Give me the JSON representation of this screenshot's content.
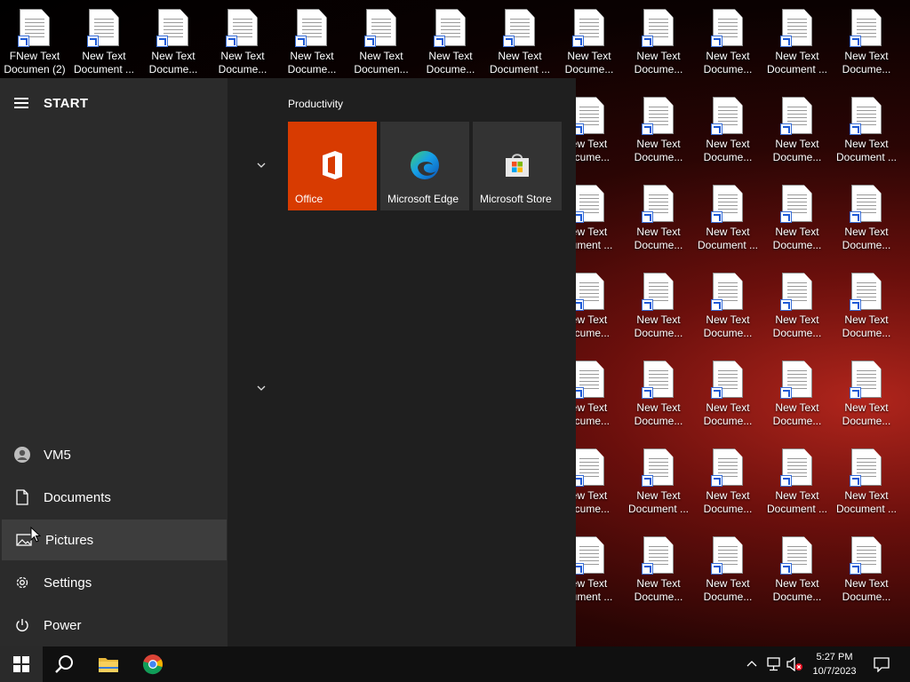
{
  "desktop": {
    "rows": [
      [
        "FNew Text Documen (2)",
        "New Text Document ...",
        "New Text Docume...",
        "New Text Docume...",
        "New Text Docume...",
        "New Text Documen...",
        "New Text Docume...",
        "New Text Document ...",
        "New Text Docume...",
        "New Text Docume...",
        "New Text Docume...",
        "New Text Document ...",
        "New Text Docume..."
      ],
      [
        "",
        "",
        "",
        "",
        "",
        "",
        "",
        "",
        "ew Text ocume...",
        "New Text Docume...",
        "New Text Docume...",
        "New Text Docume...",
        "New Text Document ..."
      ],
      [
        "",
        "",
        "",
        "",
        "",
        "",
        "",
        "",
        "ew Text cument ...",
        "New Text Docume...",
        "New Text Document ...",
        "New Text Docume...",
        "New Text Docume..."
      ],
      [
        "",
        "",
        "",
        "",
        "",
        "",
        "",
        "",
        "ew Text ocume...",
        "New Text Docume...",
        "New Text Docume...",
        "New Text Docume...",
        "New Text Docume..."
      ],
      [
        "",
        "",
        "",
        "",
        "",
        "",
        "",
        "",
        "ew Text ocume...",
        "New Text Docume...",
        "New Text Docume...",
        "New Text Docume...",
        "New Text Docume..."
      ],
      [
        "",
        "",
        "",
        "",
        "",
        "",
        "",
        "",
        "ew Text ocume...",
        "New Text Document ...",
        "New Text Docume...",
        "New Text Document ...",
        "New Text Document ..."
      ],
      [
        "",
        "",
        "",
        "",
        "",
        "",
        "",
        "",
        "ew Text cument ...",
        "New Text Docume...",
        "New Text Docume...",
        "New Text Docume...",
        "New Text Docume..."
      ]
    ]
  },
  "start_menu": {
    "title": "START",
    "user": "VM5",
    "items": [
      "Documents",
      "Pictures",
      "Settings",
      "Power"
    ],
    "group_title": "Productivity",
    "tiles": [
      {
        "label": "Office",
        "color": "#d83b01"
      },
      {
        "label": "Microsoft Edge",
        "color": "#333333"
      },
      {
        "label": "Microsoft Store",
        "color": "#333333"
      }
    ]
  },
  "taskbar": {
    "time": "5:27 PM",
    "date": "10/7/2023"
  }
}
